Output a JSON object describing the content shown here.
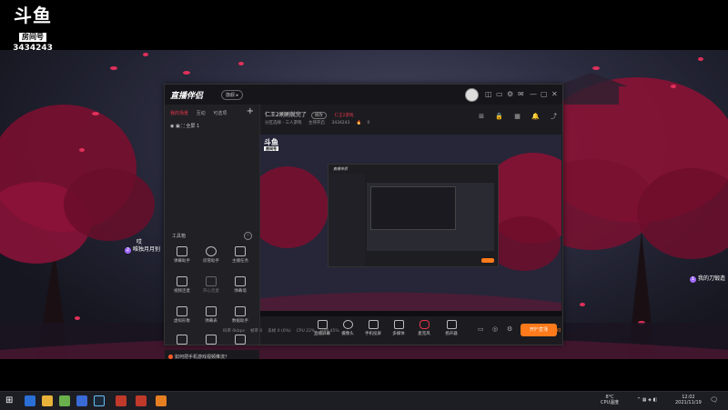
{
  "overlay": {
    "logo_text": "斗鱼",
    "room_label": "房间号",
    "room_id": "3434243"
  },
  "danmu": [
    {
      "num": "2",
      "text": "唯独月月别"
    },
    {
      "num": "",
      "text": "哎"
    },
    {
      "num": "1",
      "text": "我的刀锻造"
    },
    {
      "num": "",
      "text": "哎"
    }
  ],
  "app": {
    "logo": "直播伴侣",
    "badge": "旗舰 ▸",
    "window_controls": [
      "◫",
      "▭",
      "⚙",
      "✉",
      "—",
      "▢",
      "✕"
    ],
    "sidebar": {
      "tabs": [
        {
          "label": "我的场景",
          "active": true
        },
        {
          "label": "互动",
          "active": false
        },
        {
          "label": "可选项",
          "active": false
        }
      ],
      "add_label": "+",
      "scene_item": "全屏 1",
      "tools_title": "工具箱",
      "tools_more": "›",
      "tools": [
        {
          "label": "弹幕助手",
          "icon": "danmu-icon"
        },
        {
          "label": "房管助手",
          "icon": "user-icon"
        },
        {
          "label": "主播任务",
          "icon": "gift-icon"
        },
        {
          "label": "视频连麦",
          "icon": "mic-icon"
        },
        {
          "label": "开心连麦",
          "icon": "smile-icon"
        },
        {
          "label": "弹幕墙",
          "icon": "wall-icon"
        },
        {
          "label": "虚拟形象",
          "icon": "avatar-icon"
        },
        {
          "label": "弹幕表",
          "icon": "list-icon"
        },
        {
          "label": "数据助手",
          "icon": "chart-icon"
        },
        {
          "label": "",
          "icon": "heart-icon"
        },
        {
          "label": "",
          "icon": "download-icon"
        },
        {
          "label": "",
          "icon": "grid-icon"
        }
      ],
      "notice": "如何把手机游戏视频推流？"
    },
    "header": {
      "room_title": "仁王2刷刷就完了",
      "tag1": "修改",
      "tag2": "仁王2游戏",
      "info": [
        "分区选择 - 三人游戏",
        "主持开启",
        "3434243",
        "0"
      ],
      "icons": [
        "⊞",
        "🔒",
        "▦",
        "🔔",
        "⤴"
      ]
    },
    "preview": {
      "logo": "斗鱼",
      "logo_sub": "房间号",
      "inner_logo": "直播伴侣"
    },
    "controls": [
      {
        "label": "直播屏幕",
        "icon": "screen-icon"
      },
      {
        "label": "摄像头",
        "icon": "camera-icon"
      },
      {
        "label": "手机投屏",
        "icon": "phone-icon"
      },
      {
        "label": "多媒体",
        "icon": "media-icon"
      },
      {
        "label": "麦克风",
        "icon": "microphone-icon"
      },
      {
        "label": "扬声器",
        "icon": "speaker-icon"
      }
    ],
    "golive_label": "开始直播",
    "status": [
      "码率 0kbps",
      "帧率 0",
      "丢帧 0 (0%)",
      "CPU 22%",
      "内存 45%"
    ],
    "record": "00:00:00"
  },
  "taskbar": {
    "weather": "8°C",
    "weather_sub": "CPU温度",
    "time": "12:02",
    "date": "2021/11/19"
  }
}
